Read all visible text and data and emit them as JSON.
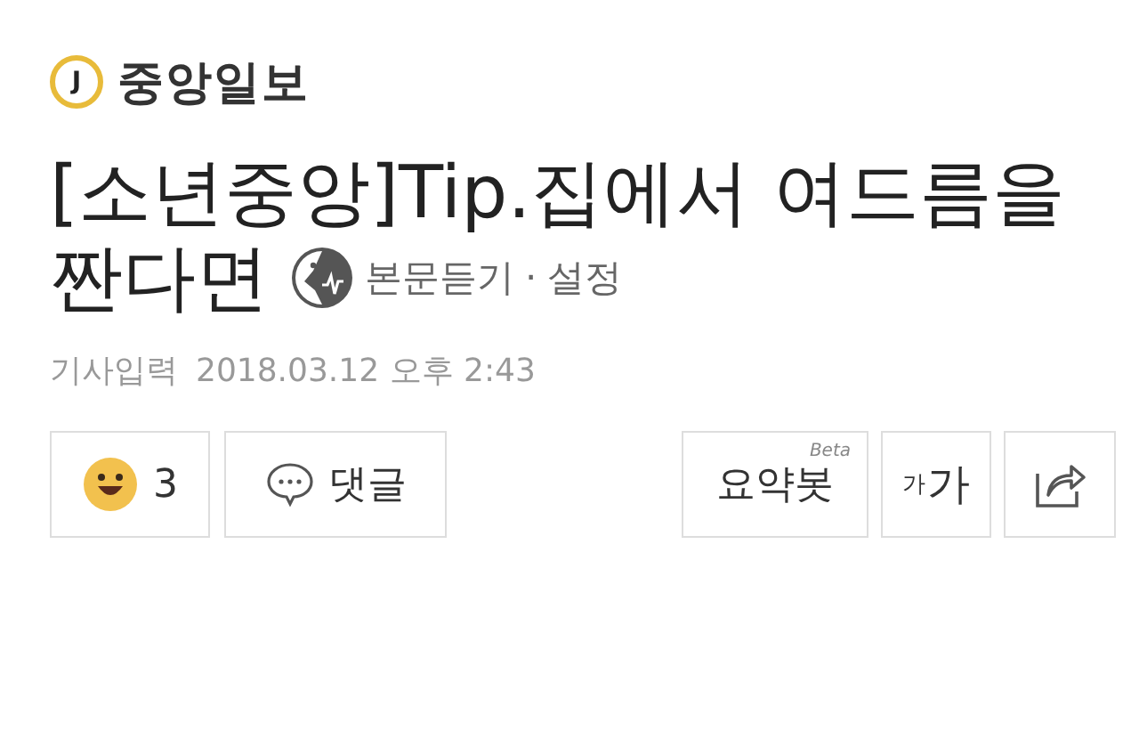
{
  "logo": {
    "badge": "J",
    "name": "중앙일보"
  },
  "headline": {
    "line_1": "[소년중앙]Tip.집에서 여드름을",
    "line_2": "짠다면"
  },
  "listen": {
    "label": "본문듣기",
    "separator": "·",
    "settings": "설정"
  },
  "date": {
    "label": "기사입력",
    "value": "2018.03.12 오후 2:43"
  },
  "actions": {
    "reaction_count": "3",
    "comments": "댓글",
    "summary_bot": "요약봇",
    "beta": "Beta",
    "font_small": "가",
    "font_large": "가"
  }
}
